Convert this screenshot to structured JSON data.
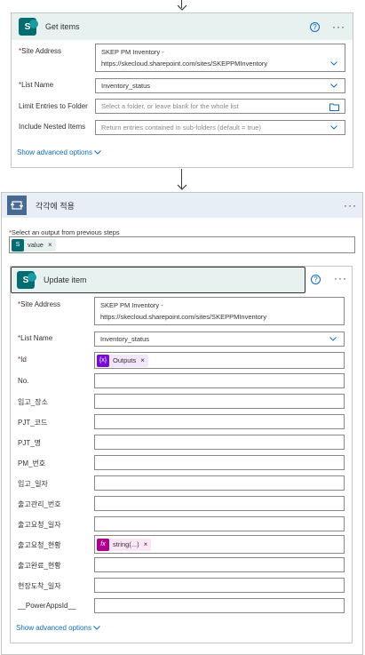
{
  "get_items": {
    "title": "Get items",
    "fields": [
      {
        "label": "Site Address",
        "required": true,
        "value_line1": "SKEP PM Inventory -",
        "value_line2": "https://skecloud.sharepoint.com/sites/SKEPPMInventory"
      },
      {
        "label": "List Name",
        "required": true,
        "value": "Inventory_status"
      },
      {
        "label": "Limit Entries to Folder",
        "required": false,
        "placeholder": "Select a folder, or leave blank for the whole list"
      },
      {
        "label": "Include Nested Items",
        "required": false,
        "placeholder": "Return entries contained in sub-folders (default = true)"
      }
    ],
    "advanced": "Show advanced options"
  },
  "foreach": {
    "title": "각각에 적용",
    "select_label": "Select an output from previous steps",
    "token": "value"
  },
  "update_item": {
    "title": "Update item",
    "site_label": "Site Address",
    "site_line1": "SKEP PM Inventory -",
    "site_line2": "https://skecloud.sharepoint.com/sites/SKEPPMInventory",
    "list_label": "List Name",
    "list_value": "Inventory_status",
    "id_label": "Id",
    "id_token": "Outputs",
    "fields": [
      {
        "label": "No.",
        "value": ""
      },
      {
        "label": "입고_장소",
        "value": ""
      },
      {
        "label": "PJT_코드",
        "value": ""
      },
      {
        "label": "PJT_명",
        "value": ""
      },
      {
        "label": "PM_번호",
        "value": ""
      },
      {
        "label": "입고_일자",
        "value": ""
      },
      {
        "label": "출고관리_번호",
        "value": ""
      },
      {
        "label": "출고요청_일자",
        "value": ""
      },
      {
        "label": "출고요청_현황",
        "token": "string(...)"
      },
      {
        "label": "출고완료_현황",
        "value": ""
      },
      {
        "label": "현장도착_일자",
        "value": ""
      },
      {
        "label": "__PowerAppsId__",
        "value": ""
      }
    ],
    "advanced": "Show advanced options"
  },
  "colors": {
    "sharepoint": "#036c70",
    "loop": "#486991",
    "fx": "#ad008c",
    "var": "#770bd6",
    "link": "#0f6cbd"
  }
}
